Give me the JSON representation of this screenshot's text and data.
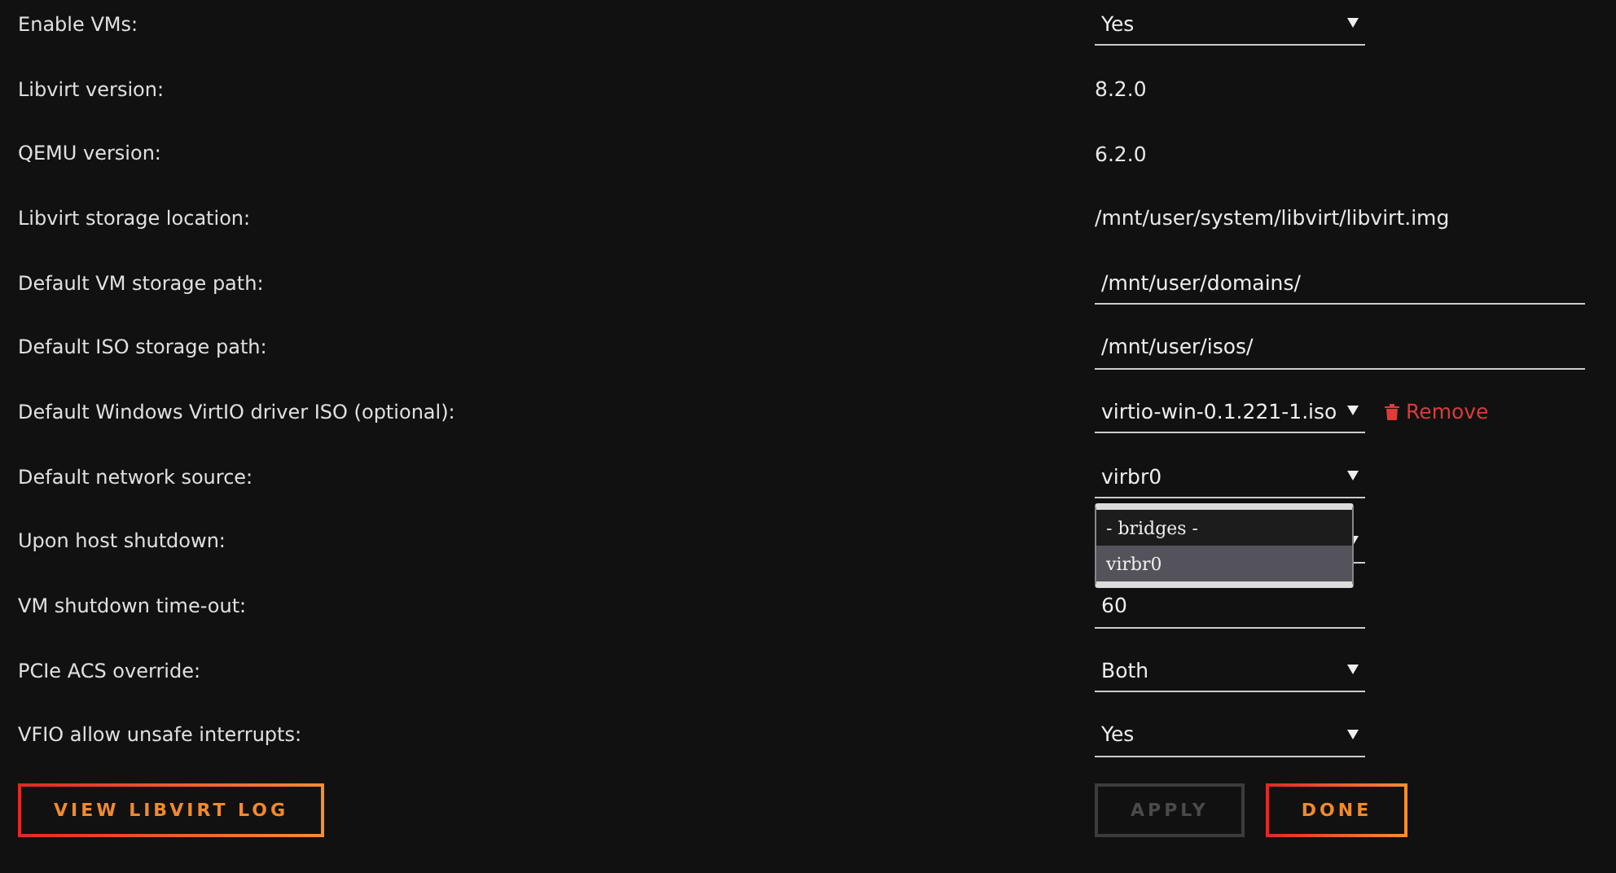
{
  "settings": [
    {
      "label": "Enable VMs:",
      "kind": "select",
      "value": "Yes"
    },
    {
      "label": "Libvirt version:",
      "kind": "text",
      "value": "8.2.0"
    },
    {
      "label": "QEMU version:",
      "kind": "text",
      "value": "6.2.0"
    },
    {
      "label": "Libvirt storage location:",
      "kind": "text",
      "value": "/mnt/user/system/libvirt/libvirt.img"
    },
    {
      "label": "Default VM storage path:",
      "kind": "input",
      "value": "/mnt/user/domains/"
    },
    {
      "label": "Default ISO storage path:",
      "kind": "input",
      "value": "/mnt/user/isos/"
    },
    {
      "label": "Default Windows VirtIO driver ISO (optional):",
      "kind": "select",
      "value": "virtio-win-0.1.221-1.iso",
      "action": "Remove"
    },
    {
      "label": "Default network source:",
      "kind": "select",
      "value": "virbr0",
      "open": true,
      "options": [
        {
          "label": "- bridges -",
          "selected": false
        },
        {
          "label": "virbr0",
          "selected": true
        }
      ]
    },
    {
      "label": "Upon host shutdown:",
      "kind": "select"
    },
    {
      "label": "VM shutdown time-out:",
      "kind": "short-input",
      "value": "60"
    },
    {
      "label": "PCIe ACS override:",
      "kind": "select",
      "value": "Both"
    },
    {
      "label": "VFIO allow unsafe interrupts:",
      "kind": "select",
      "value": "Yes"
    }
  ],
  "left_button": {
    "label": "VIEW LIBVIRT LOG",
    "disabled": false
  },
  "buttons": [
    {
      "label": "APPLY",
      "disabled": true
    },
    {
      "label": "DONE",
      "disabled": false
    }
  ]
}
